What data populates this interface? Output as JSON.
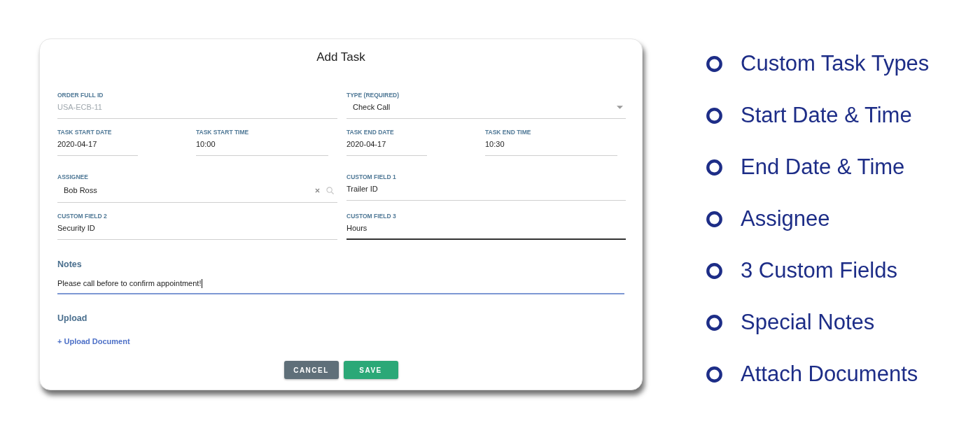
{
  "dialog": {
    "title": "Add Task",
    "rows": [
      {
        "left": [
          {
            "kind": "text",
            "label": "ORDER FULL ID",
            "value": "USA-ECB-11",
            "disabled": true,
            "hovered": false
          }
        ],
        "right": [
          {
            "kind": "select",
            "label": "TYPE (REQUIRED)",
            "value": "Check Call",
            "disabled": false,
            "hovered": false
          }
        ]
      },
      {
        "left": [
          {
            "kind": "date",
            "label": "TASK START DATE",
            "value": "2020-04-17",
            "disabled": false,
            "hovered": false
          },
          {
            "kind": "time",
            "label": "TASK START TIME",
            "value": "10:00",
            "disabled": false,
            "hovered": false
          }
        ],
        "right": [
          {
            "kind": "date",
            "label": "TASK END DATE",
            "value": "2020-04-17",
            "disabled": false,
            "hovered": false
          },
          {
            "kind": "time",
            "label": "TASK END TIME",
            "value": "10:30",
            "disabled": false,
            "hovered": false
          }
        ]
      },
      {
        "left": [
          {
            "kind": "search",
            "label": "ASSIGNEE",
            "value": "Bob Ross",
            "disabled": false,
            "hovered": false
          }
        ],
        "right": [
          {
            "kind": "text",
            "label": "CUSTOM FIELD 1",
            "value": "Trailer ID",
            "disabled": false,
            "hovered": false
          }
        ]
      },
      {
        "left": [
          {
            "kind": "text",
            "label": "CUSTOM FIELD 2",
            "value": "Security ID",
            "disabled": false,
            "hovered": false
          }
        ],
        "right": [
          {
            "kind": "text",
            "label": "CUSTOM FIELD 3",
            "value": "Hours",
            "disabled": false,
            "hovered": true
          }
        ]
      }
    ],
    "notes": {
      "heading": "Notes",
      "value": "Please call before to confirm appointment!",
      "focused": true
    },
    "upload": {
      "heading": "Upload",
      "link": "+ Upload Document"
    },
    "buttons": [
      {
        "kind": "cancel",
        "label": "CANCEL"
      },
      {
        "kind": "save",
        "label": "SAVE"
      }
    ]
  },
  "features": [
    "Custom Task Types",
    "Start Date & Time",
    "End Date & Time",
    "Assignee",
    "3 Custom Fields",
    "Special Notes",
    "Attach Documents"
  ]
}
